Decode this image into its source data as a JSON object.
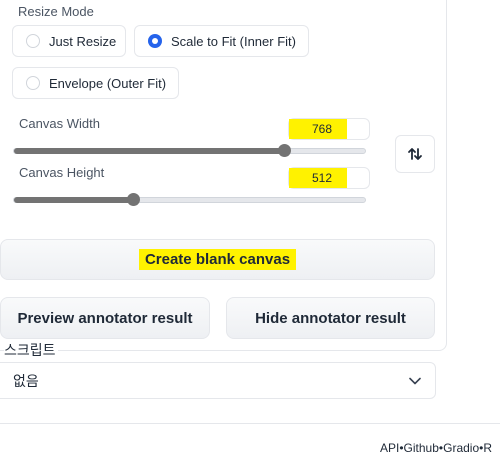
{
  "resize_mode": {
    "label": "Resize Mode",
    "options": [
      {
        "label": "Just Resize",
        "selected": false
      },
      {
        "label": "Scale to Fit (Inner Fit)",
        "selected": true
      },
      {
        "label": "Envelope (Outer Fit)",
        "selected": false
      }
    ]
  },
  "canvas_width": {
    "label": "Canvas Width",
    "value": "768",
    "fraction": 0.77
  },
  "canvas_height": {
    "label": "Canvas Height",
    "value": "512",
    "fraction": 0.34
  },
  "swap_icon": "swap-vertical-arrows-icon",
  "buttons": {
    "create_blank_canvas": "Create blank canvas",
    "preview_annotator": "Preview annotator result",
    "hide_annotator": "Hide annotator result"
  },
  "script": {
    "label": "스크립트",
    "value": "없음"
  },
  "footer": {
    "api": "API",
    "sep": "•",
    "github": "Github",
    "gradio": "Gradio",
    "more": "R"
  },
  "colors": {
    "accent": "#2563eb",
    "highlight": "#fff200",
    "slider": "#737373"
  }
}
